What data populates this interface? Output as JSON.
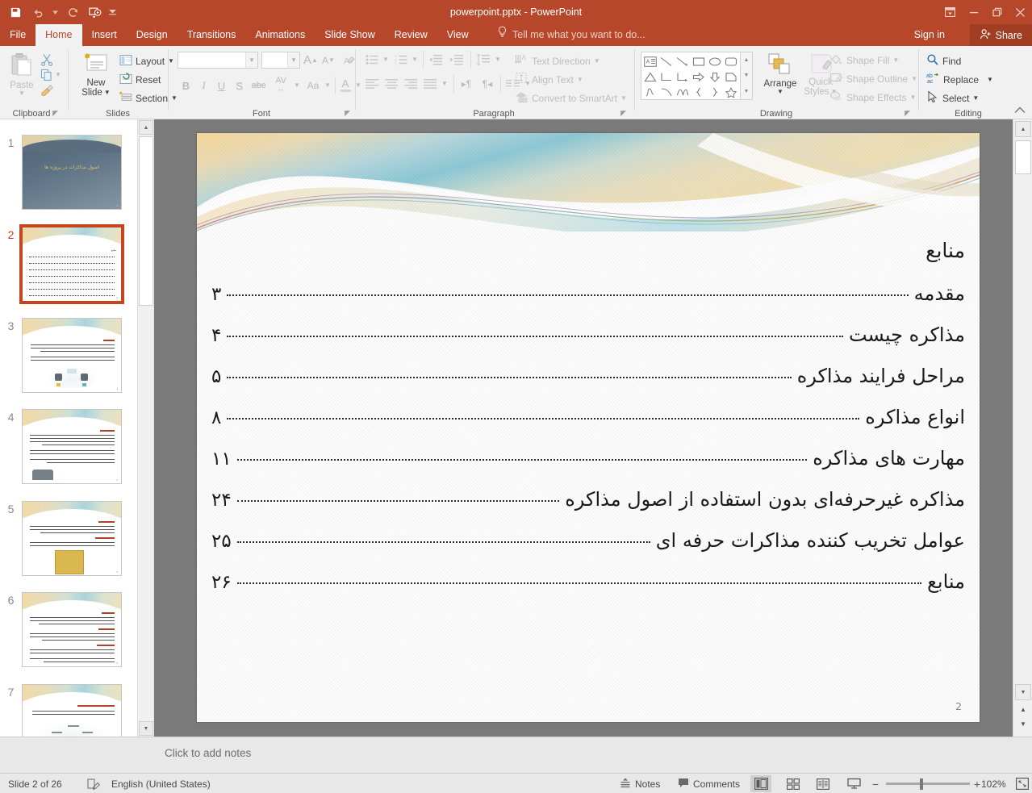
{
  "window": {
    "title": "powerpoint.pptx - PowerPoint",
    "accent": "#b7472a",
    "ribbon_bg": "#f1f1f1"
  },
  "quick_access": [
    {
      "name": "save-button",
      "icon": "save-icon"
    },
    {
      "name": "undo-button",
      "icon": "undo-icon"
    },
    {
      "name": "redo-button",
      "icon": "redo-icon"
    },
    {
      "name": "start-slideshow-button",
      "icon": "slideshow-icon"
    },
    {
      "name": "customize-qat-button",
      "icon": "chevron-down-icon"
    }
  ],
  "window_controls": {
    "ribbon_display_options": "ribbon-options-icon",
    "minimize": "minimize-icon",
    "restore": "restore-icon",
    "close": "close-icon"
  },
  "tabs": [
    {
      "label": "File",
      "active": false
    },
    {
      "label": "Home",
      "active": true
    },
    {
      "label": "Insert",
      "active": false
    },
    {
      "label": "Design",
      "active": false
    },
    {
      "label": "Transitions",
      "active": false
    },
    {
      "label": "Animations",
      "active": false
    },
    {
      "label": "Slide Show",
      "active": false
    },
    {
      "label": "Review",
      "active": false
    },
    {
      "label": "View",
      "active": false
    }
  ],
  "tellme": {
    "label": "Tell me what you want to do...",
    "icon": "lightbulb-icon"
  },
  "account": {
    "signin_label": "Sign in",
    "share_label": "Share",
    "share_icon": "person-add-icon"
  },
  "ribbon": {
    "groups": [
      {
        "name": "clipboard",
        "label": "Clipboard"
      },
      {
        "name": "slides",
        "label": "Slides"
      },
      {
        "name": "font",
        "label": "Font"
      },
      {
        "name": "paragraph",
        "label": "Paragraph"
      },
      {
        "name": "drawing",
        "label": "Drawing"
      },
      {
        "name": "editing",
        "label": "Editing"
      }
    ],
    "clipboard": {
      "paste_label": "Paste",
      "cut_icon": "scissors-icon",
      "copy_icon": "copy-icon",
      "format_painter_icon": "format-painter-icon"
    },
    "slides": {
      "new_slide_label_1": "New",
      "new_slide_label_2": "Slide",
      "layout_label": "Layout",
      "reset_label": "Reset",
      "section_label": "Section"
    },
    "font": {
      "font_name_value": "",
      "font_size_value": "",
      "increase_size_label": "A",
      "decrease_size_label": "A",
      "clear_formatting_icon": "clear-formatting-icon",
      "bold_label": "B",
      "italic_label": "I",
      "underline_label": "U",
      "shadow_label": "S",
      "strikethrough_label": "abc",
      "char_spacing_label": "AV",
      "change_case_label": "Aa",
      "font_color_label": "A"
    },
    "paragraph": {
      "text_direction_label": "Text Direction",
      "align_text_label": "Align Text",
      "convert_smartart_label": "Convert to SmartArt"
    },
    "drawing": {
      "arrange_label": "Arrange",
      "quick_styles_label_1": "Quick",
      "quick_styles_label_2": "Styles",
      "shape_fill_label": "Shape Fill",
      "shape_outline_label": "Shape Outline",
      "shape_effects_label": "Shape Effects"
    },
    "editing": {
      "find_label": "Find",
      "replace_label": "Replace",
      "select_label": "Select",
      "find_icon": "magnifier-icon",
      "replace_icon": "replace-icon",
      "select_icon": "cursor-icon"
    },
    "collapse_icon": "chevron-up-icon"
  },
  "slide_panel": {
    "thumbnails": [
      {
        "number": "1",
        "selected": false,
        "kind": "title",
        "title": "اصول مذاکرات در پروژه ها"
      },
      {
        "number": "2",
        "selected": true,
        "kind": "toc"
      },
      {
        "number": "3",
        "selected": false,
        "kind": "text-image"
      },
      {
        "number": "4",
        "selected": false,
        "kind": "text-image"
      },
      {
        "number": "5",
        "selected": false,
        "kind": "text-book"
      },
      {
        "number": "6",
        "selected": false,
        "kind": "text-only"
      },
      {
        "number": "7",
        "selected": false,
        "kind": "diagram"
      }
    ]
  },
  "slide": {
    "page_number": "2",
    "toc_title": "منابع",
    "toc_entries": [
      {
        "label": "مقدمه",
        "page": "۳"
      },
      {
        "label": "مذاکره چیست",
        "page": "۴"
      },
      {
        "label": "مراحل فرایند مذاکره",
        "page": "۵"
      },
      {
        "label": "انواع مذاکره",
        "page": "۸"
      },
      {
        "label": "مهارت های مذاکره",
        "page": "۱۱"
      },
      {
        "label": "مذاکره غیرحرفه‌ای بدون استفاده از اصول مذاکره",
        "page": "۲۴"
      },
      {
        "label": "عوامل تخریب کننده مذاکرات حرفه ای",
        "page": "۲۵"
      },
      {
        "label": "منابع",
        "page": "۲۶"
      }
    ]
  },
  "notes": {
    "placeholder": "Click to add notes"
  },
  "status_bar": {
    "slide_indicator": "Slide 2 of 26",
    "language": "English (United States)",
    "spellcheck_icon": "spellcheck-icon",
    "notes_label": "Notes",
    "comments_label": "Comments",
    "views": [
      {
        "name": "normal-view",
        "icon": "normal-view-icon",
        "active": true
      },
      {
        "name": "slide-sorter-view",
        "icon": "slide-sorter-icon",
        "active": false
      },
      {
        "name": "reading-view",
        "icon": "reading-view-icon",
        "active": false
      },
      {
        "name": "slideshow-view",
        "icon": "slideshow-view-icon",
        "active": false
      }
    ],
    "zoom_out_label": "−",
    "zoom_in_label": "+",
    "zoom_level": "102%",
    "fit_slide_icon": "fit-to-window-icon"
  }
}
